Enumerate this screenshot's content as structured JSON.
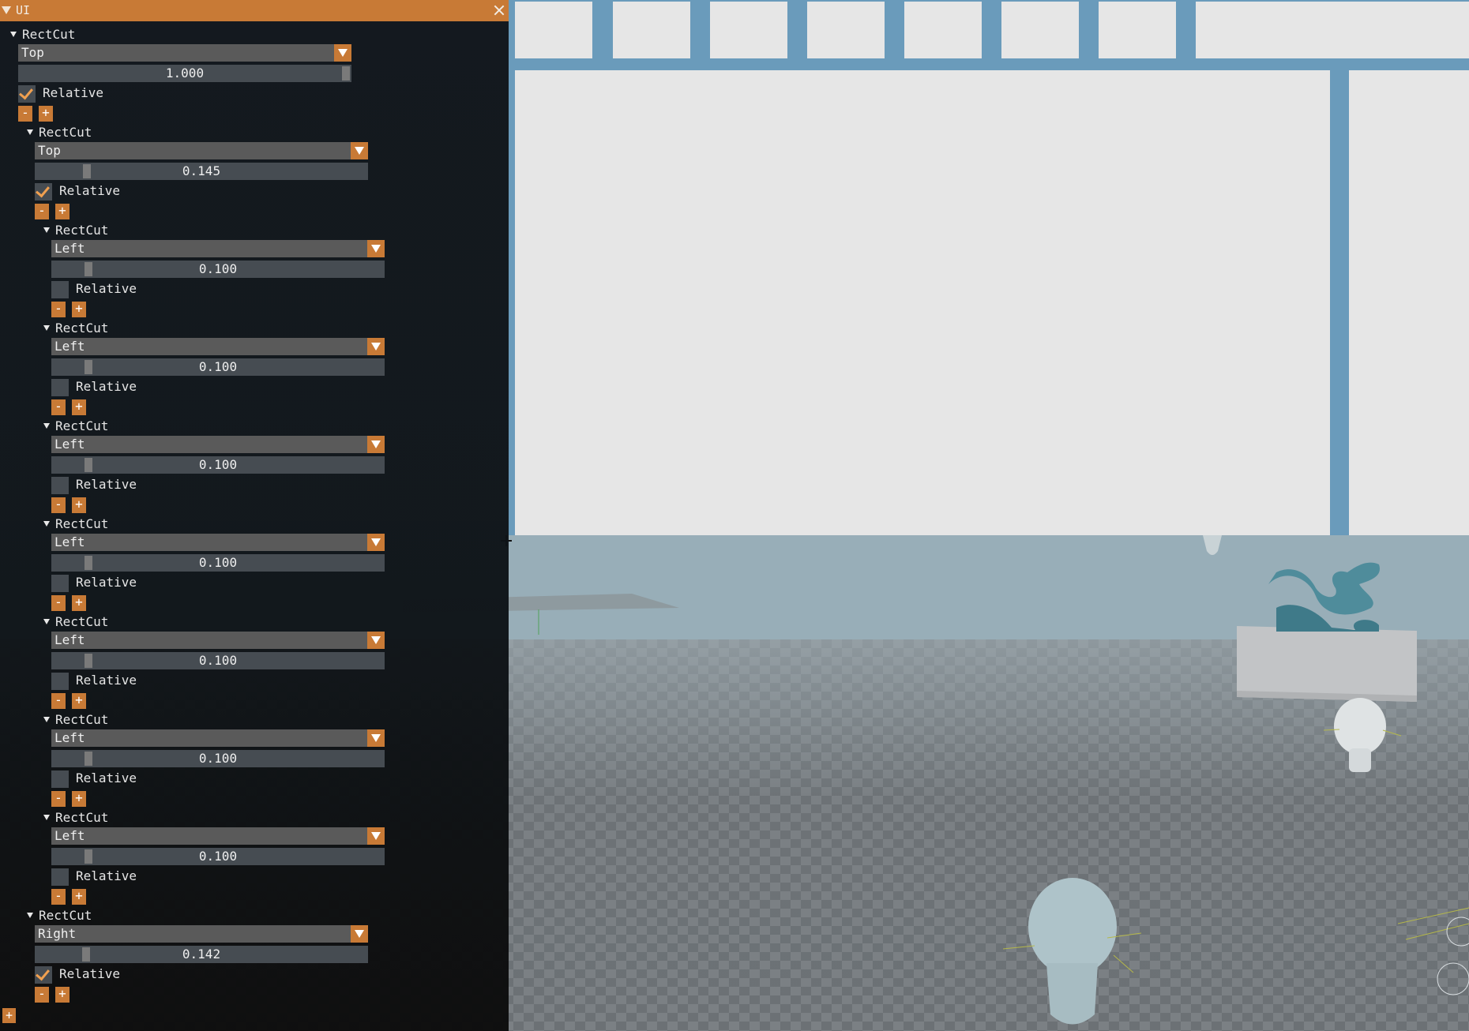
{
  "window": {
    "title": "UI"
  },
  "root": {
    "label": "RectCut",
    "combo": "Top",
    "slider": "1.000",
    "relative_label": "Relative",
    "relative": true,
    "minus": "-",
    "plus": "+",
    "children": [
      {
        "label": "RectCut",
        "combo": "Top",
        "slider": "0.145",
        "relative_label": "Relative",
        "relative": true,
        "minus": "-",
        "plus": "+",
        "children": [
          {
            "label": "RectCut",
            "combo": "Left",
            "slider": "0.100",
            "relative_label": "Relative",
            "relative": false,
            "minus": "-",
            "plus": "+"
          },
          {
            "label": "RectCut",
            "combo": "Left",
            "slider": "0.100",
            "relative_label": "Relative",
            "relative": false,
            "minus": "-",
            "plus": "+"
          },
          {
            "label": "RectCut",
            "combo": "Left",
            "slider": "0.100",
            "relative_label": "Relative",
            "relative": false,
            "minus": "-",
            "plus": "+"
          },
          {
            "label": "RectCut",
            "combo": "Left",
            "slider": "0.100",
            "relative_label": "Relative",
            "relative": false,
            "minus": "-",
            "plus": "+"
          },
          {
            "label": "RectCut",
            "combo": "Left",
            "slider": "0.100",
            "relative_label": "Relative",
            "relative": false,
            "minus": "-",
            "plus": "+"
          },
          {
            "label": "RectCut",
            "combo": "Left",
            "slider": "0.100",
            "relative_label": "Relative",
            "relative": false,
            "minus": "-",
            "plus": "+"
          },
          {
            "label": "RectCut",
            "combo": "Left",
            "slider": "0.100",
            "relative_label": "Relative",
            "relative": false,
            "minus": "-",
            "plus": "+"
          }
        ]
      },
      {
        "label": "RectCut",
        "combo": "Right",
        "slider": "0.142",
        "relative_label": "Relative",
        "relative": true,
        "minus": "-",
        "plus": "+"
      }
    ]
  },
  "root_add": "+",
  "colors": {
    "accent": "#c87a36",
    "panel": "#0f1419",
    "frame": "#6a9bbb",
    "cell": "#e6e6e6"
  },
  "icons": {
    "collapse": "triangle-down-icon",
    "close": "close-icon",
    "dropdown": "chevron-down-icon",
    "check": "checkmark-icon"
  }
}
